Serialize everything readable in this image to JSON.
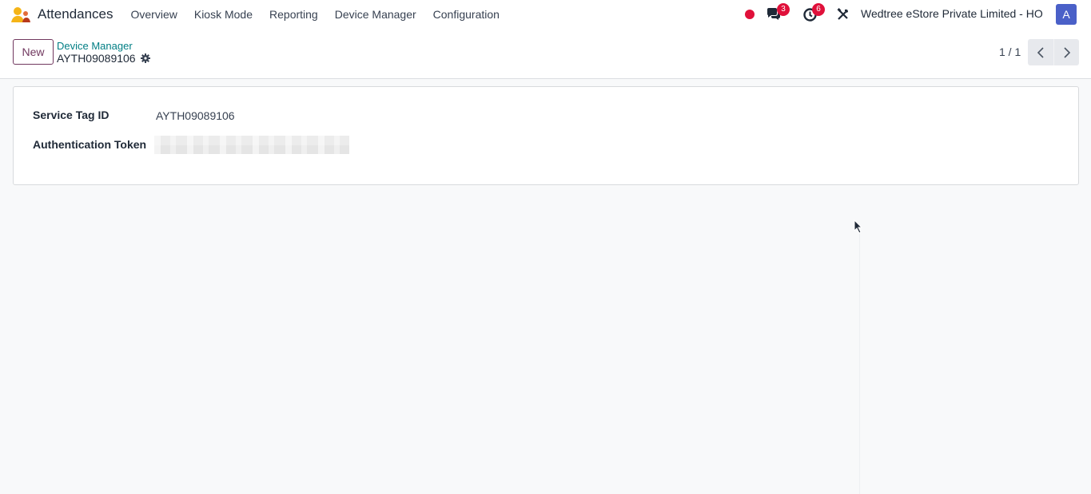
{
  "app": {
    "name": "Attendances",
    "logo_icon": "attendances-logo-icon"
  },
  "menu": [
    {
      "label": "Overview"
    },
    {
      "label": "Kiosk Mode"
    },
    {
      "label": "Reporting"
    },
    {
      "label": "Device Manager"
    },
    {
      "label": "Configuration"
    }
  ],
  "systray": {
    "recording_color": "#e0103a",
    "messages_badge": "3",
    "activities_badge": "6",
    "company": "Wedtree eStore Private Limited - HO",
    "avatar_initial": "A",
    "avatar_color": "#4a60c8"
  },
  "control_panel": {
    "new_label": "New",
    "breadcrumb": "Device Manager",
    "record_name": "AYTH09089106",
    "pager": "1 / 1"
  },
  "form": {
    "service_tag_label": "Service Tag ID",
    "service_tag_value": "AYTH09089106",
    "auth_token_label": "Authentication Token"
  },
  "colors": {
    "accent": "#71385f",
    "link": "#017e84",
    "badge": "#e0103a"
  }
}
